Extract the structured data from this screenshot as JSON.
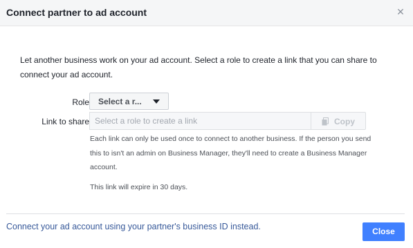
{
  "dialog": {
    "title": "Connect partner to ad account",
    "close_icon": "close-icon"
  },
  "body": {
    "description": "Let another business work on your ad account. Select a role to create a link that you can share to connect your ad account.",
    "role_label": "Role",
    "role_select_value": "Select a r...",
    "link_label": "Link to share",
    "link_placeholder": "Select a role to create a link",
    "copy_label": "Copy",
    "copy_icon": "copy-icon",
    "note": "Each link can only be used once to connect to another business. If the person you send this to isn't an admin on Business Manager, they'll need to create a Business Manager account.",
    "expire_note": "This link will expire in 30 days."
  },
  "footer": {
    "alt_link": "Connect your ad account using your partner's business ID instead.",
    "close_label": "Close"
  },
  "colors": {
    "primary": "#4080ff",
    "link": "#365899",
    "header_bg": "#f5f6f7"
  }
}
